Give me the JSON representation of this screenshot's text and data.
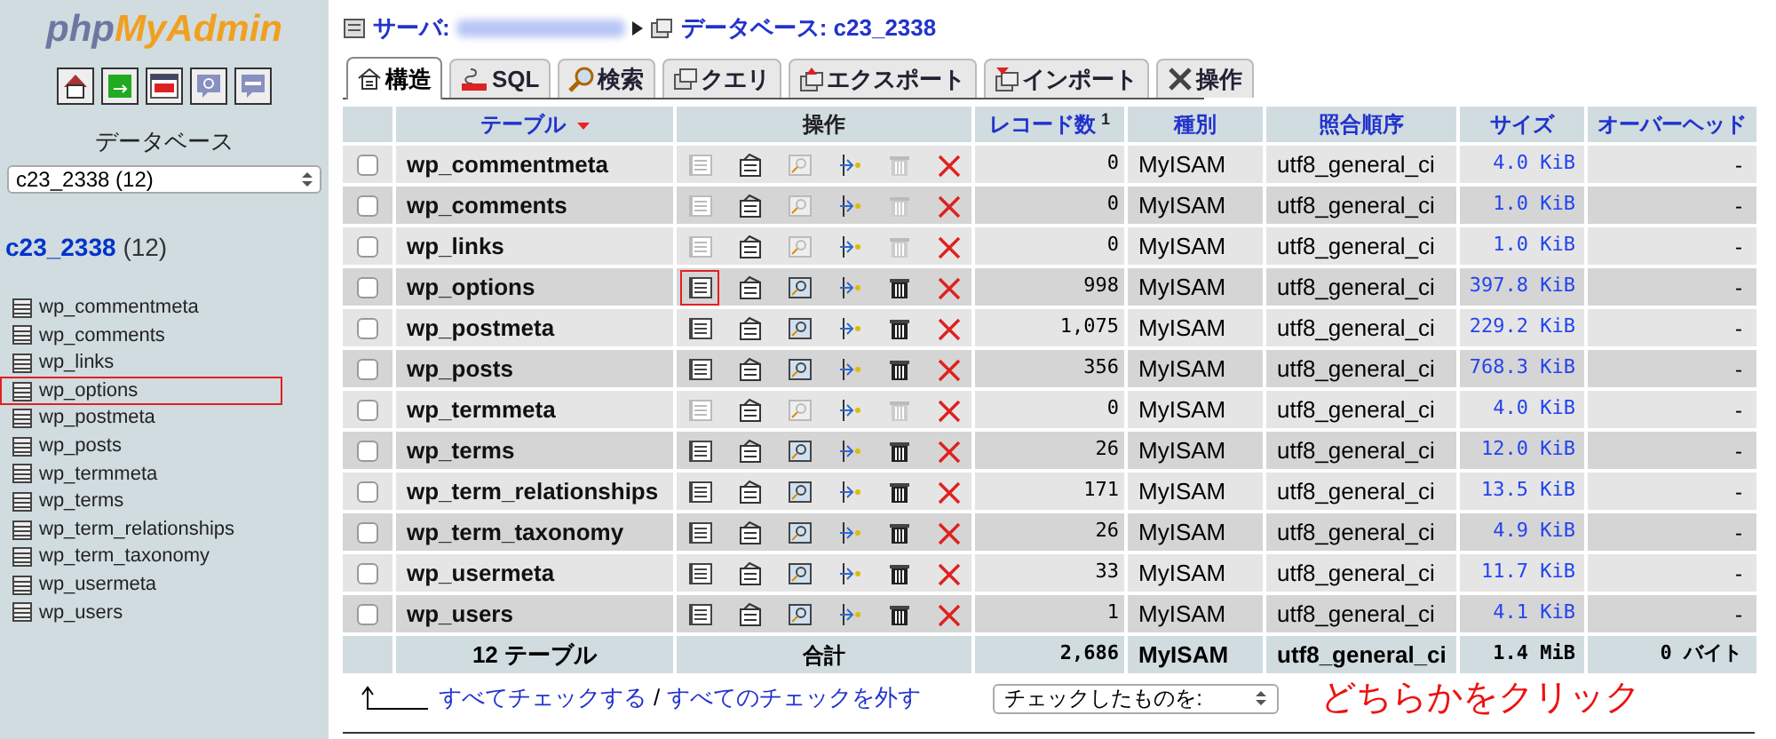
{
  "logo": {
    "part_1": "php",
    "part_2": "MyAdmin"
  },
  "sidebar": {
    "database_label": "データベース",
    "database_select": "c23_2338 (12)",
    "db_name": "c23_2338",
    "db_count": "(12)",
    "tables": [
      {
        "name": "wp_commentmeta",
        "highlighted": false
      },
      {
        "name": "wp_comments",
        "highlighted": false
      },
      {
        "name": "wp_links",
        "highlighted": false
      },
      {
        "name": "wp_options",
        "highlighted": true
      },
      {
        "name": "wp_postmeta",
        "highlighted": false
      },
      {
        "name": "wp_posts",
        "highlighted": false
      },
      {
        "name": "wp_termmeta",
        "highlighted": false
      },
      {
        "name": "wp_terms",
        "highlighted": false
      },
      {
        "name": "wp_term_relationships",
        "highlighted": false
      },
      {
        "name": "wp_term_taxonomy",
        "highlighted": false
      },
      {
        "name": "wp_usermeta",
        "highlighted": false
      },
      {
        "name": "wp_users",
        "highlighted": false
      }
    ]
  },
  "breadcrumb": {
    "server_label": "サーバ:",
    "database": "データベース: c23_2338"
  },
  "tabs": [
    {
      "label": "構造",
      "selected": true
    },
    {
      "label": "SQL",
      "selected": false
    },
    {
      "label": "検索",
      "selected": false
    },
    {
      "label": "クエリ",
      "selected": false
    },
    {
      "label": "エクスポート",
      "selected": false
    },
    {
      "label": "インポート",
      "selected": false
    },
    {
      "label": "操作",
      "selected": false
    }
  ],
  "table": {
    "columns": [
      "テーブル",
      "操作",
      "レコード数",
      "種別",
      "照合順序",
      "サイズ",
      "オーバーヘッド"
    ],
    "records_footnote": "1",
    "rows": [
      {
        "name": "wp_commentmeta",
        "records": "0",
        "type": "MyISAM",
        "collation": "utf8_general_ci",
        "size": "4.0 KiB",
        "overhead": "-",
        "empty": true,
        "checked": false,
        "highlighted": false
      },
      {
        "name": "wp_comments",
        "records": "0",
        "type": "MyISAM",
        "collation": "utf8_general_ci",
        "size": "1.0 KiB",
        "overhead": "-",
        "empty": true,
        "checked": false,
        "highlighted": false
      },
      {
        "name": "wp_links",
        "records": "0",
        "type": "MyISAM",
        "collation": "utf8_general_ci",
        "size": "1.0 KiB",
        "overhead": "-",
        "empty": true,
        "checked": false,
        "highlighted": false
      },
      {
        "name": "wp_options",
        "records": "998",
        "type": "MyISAM",
        "collation": "utf8_general_ci",
        "size": "397.8 KiB",
        "overhead": "-",
        "empty": false,
        "checked": false,
        "highlighted": true
      },
      {
        "name": "wp_postmeta",
        "records": "1,075",
        "type": "MyISAM",
        "collation": "utf8_general_ci",
        "size": "229.2 KiB",
        "overhead": "-",
        "empty": false,
        "checked": false,
        "highlighted": false
      },
      {
        "name": "wp_posts",
        "records": "356",
        "type": "MyISAM",
        "collation": "utf8_general_ci",
        "size": "768.3 KiB",
        "overhead": "-",
        "empty": false,
        "checked": false,
        "highlighted": false
      },
      {
        "name": "wp_termmeta",
        "records": "0",
        "type": "MyISAM",
        "collation": "utf8_general_ci",
        "size": "4.0 KiB",
        "overhead": "-",
        "empty": true,
        "checked": false,
        "highlighted": false
      },
      {
        "name": "wp_terms",
        "records": "26",
        "type": "MyISAM",
        "collation": "utf8_general_ci",
        "size": "12.0 KiB",
        "overhead": "-",
        "empty": false,
        "checked": false,
        "highlighted": false
      },
      {
        "name": "wp_term_relationships",
        "records": "171",
        "type": "MyISAM",
        "collation": "utf8_general_ci",
        "size": "13.5 KiB",
        "overhead": "-",
        "empty": false,
        "checked": false,
        "highlighted": false
      },
      {
        "name": "wp_term_taxonomy",
        "records": "26",
        "type": "MyISAM",
        "collation": "utf8_general_ci",
        "size": "4.9 KiB",
        "overhead": "-",
        "empty": false,
        "checked": false,
        "highlighted": false
      },
      {
        "name": "wp_usermeta",
        "records": "33",
        "type": "MyISAM",
        "collation": "utf8_general_ci",
        "size": "11.7 KiB",
        "overhead": "-",
        "empty": false,
        "checked": false,
        "highlighted": false
      },
      {
        "name": "wp_users",
        "records": "1",
        "type": "MyISAM",
        "collation": "utf8_general_ci",
        "size": "4.1 KiB",
        "overhead": "-",
        "empty": false,
        "checked": false,
        "highlighted": false
      }
    ],
    "footer": {
      "count": "12 テーブル",
      "sum_label": "合計",
      "records": "2,686",
      "type": "MyISAM",
      "collation": "utf8_general_ci",
      "size": "1.4 MiB",
      "overhead": "0 バイト"
    }
  },
  "bulk": {
    "check_all": "すべてチェックする",
    "separator": "/",
    "uncheck_all": "すべてのチェックを外す",
    "action_select": "チェックしたものを:"
  },
  "annotation": "どちらかをクリック"
}
